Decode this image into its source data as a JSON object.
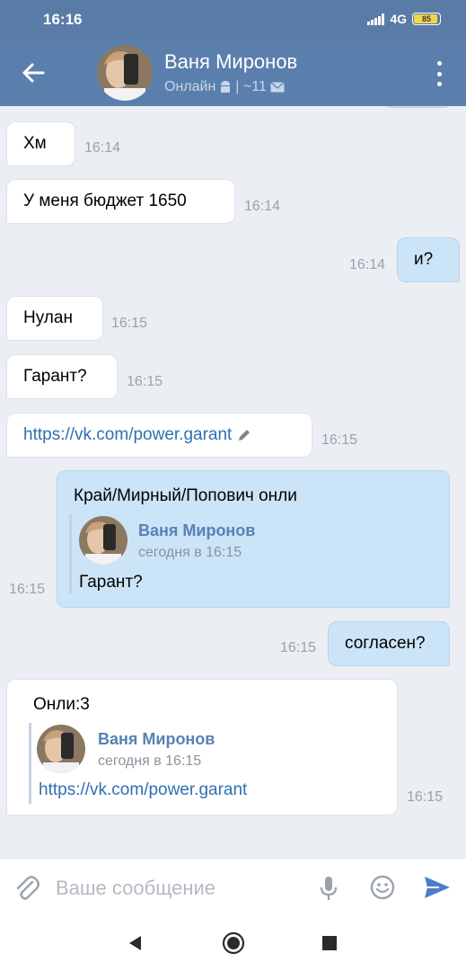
{
  "status_bar": {
    "time": "16:16",
    "network": "4G",
    "battery": "85"
  },
  "header": {
    "name": "Ваня Миронов",
    "status": "Онлайн",
    "extra": "| ~11"
  },
  "messages": [
    {
      "dir": "in",
      "text": "Хм",
      "time": "16:14"
    },
    {
      "dir": "in",
      "text": "У меня бюджет 1650",
      "time": "16:14"
    },
    {
      "dir": "out",
      "text": "и?",
      "time": "16:14"
    },
    {
      "dir": "in",
      "text": "Нулан",
      "time": "16:15"
    },
    {
      "dir": "in",
      "text": "Гарант?",
      "time": "16:15"
    },
    {
      "dir": "in",
      "text": "https://vk.com/power.garant",
      "time": "16:15"
    },
    {
      "dir": "out",
      "text": "Край/Мирный/Попович онли",
      "time": "16:15",
      "forwarded": {
        "name": "Ваня Миронов",
        "date": "сегодня в 16:15",
        "text": "Гарант?"
      }
    },
    {
      "dir": "out",
      "text": "согласен?",
      "time": "16:15"
    },
    {
      "dir": "in",
      "text": "Онли:3",
      "time": "16:15",
      "forwarded": {
        "name": "Ваня Миронов",
        "date": "сегодня в 16:15",
        "text": "https://vk.com/power.garant"
      }
    }
  ],
  "composer": {
    "placeholder": "Ваше сообщение"
  },
  "icons": [
    "back-arrow-icon",
    "android-icon",
    "mail-icon",
    "more-vert-icon",
    "pencil-icon",
    "attach-icon",
    "microphone-icon",
    "emoji-icon",
    "send-icon",
    "nav-back-icon",
    "nav-home-icon",
    "nav-recents-icon"
  ],
  "colors": {
    "header": "#5b7fad",
    "outgoing_bubble": "#cce4f7",
    "incoming_bubble": "#ffffff",
    "chat_bg": "#ebeef3",
    "link": "#2f6fb2",
    "send": "#4a7fc6"
  }
}
